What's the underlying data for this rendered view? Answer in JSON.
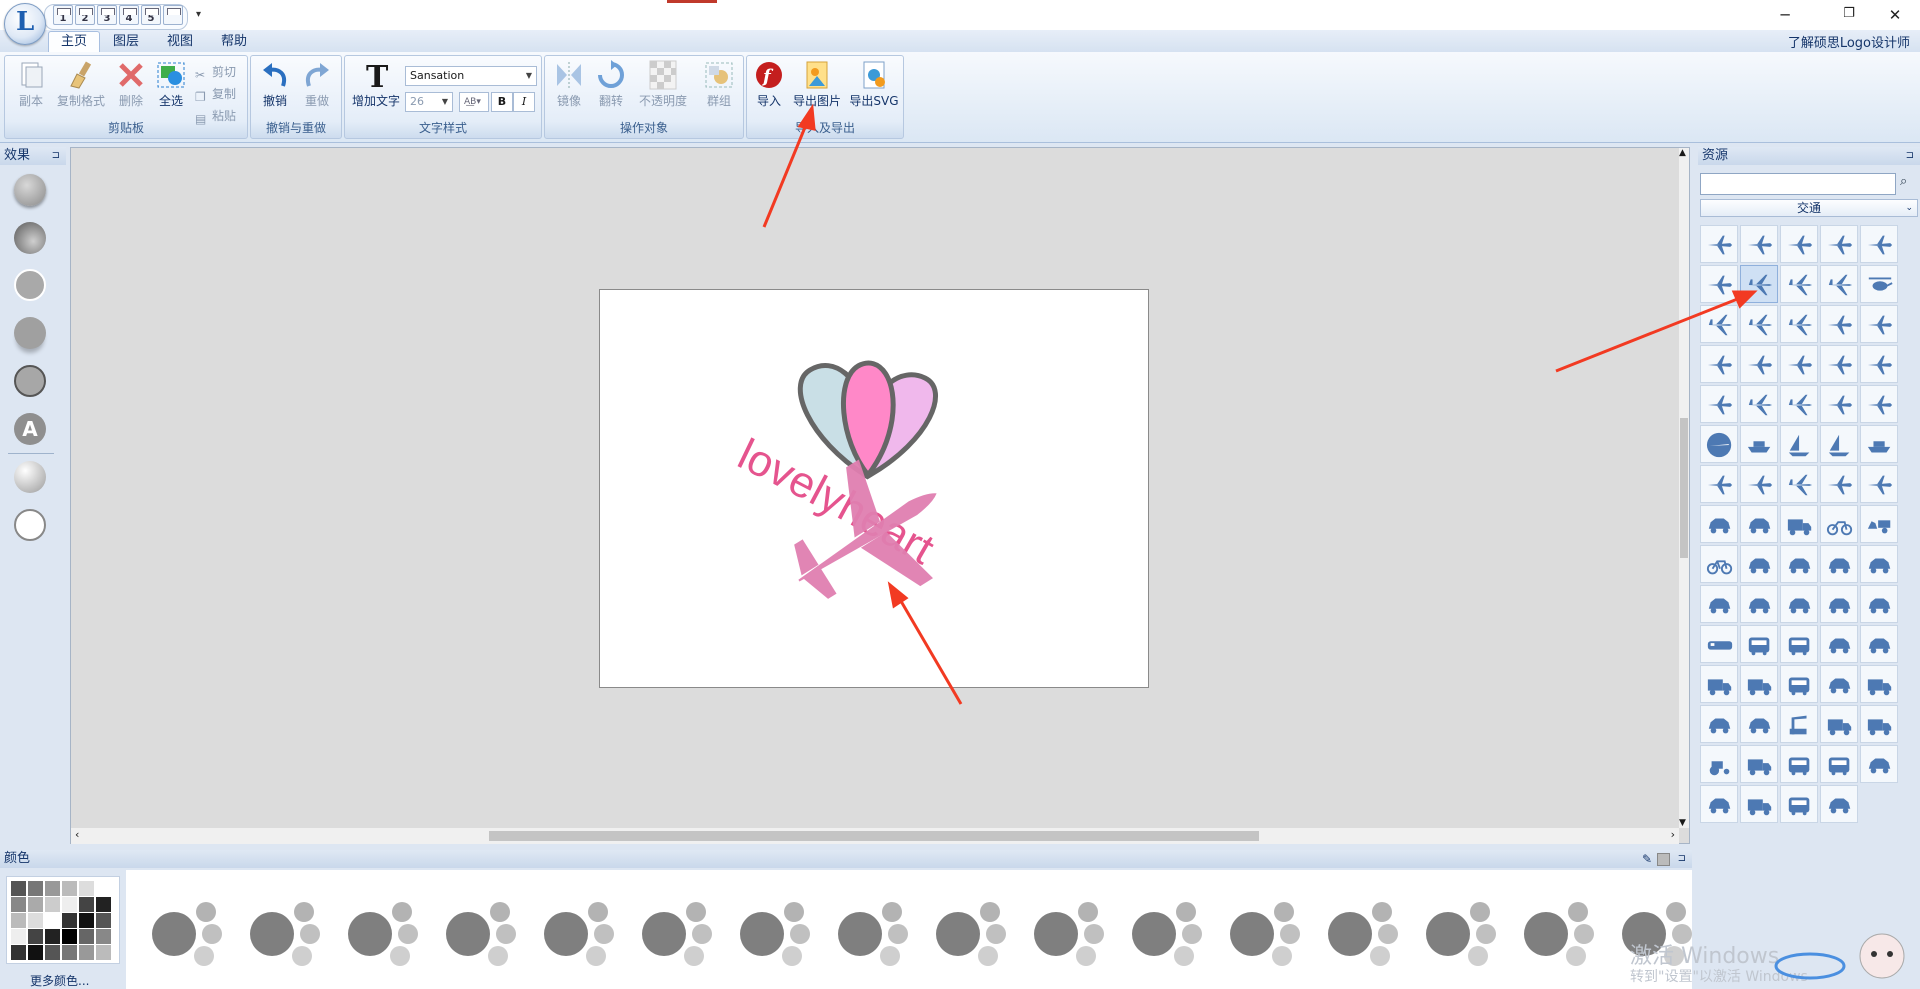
{
  "titlebar": {
    "qat_buttons": [
      "1",
      "2",
      "3",
      "4",
      "5"
    ],
    "help_link": "了解硕思Logo设计师"
  },
  "menu": {
    "tabs": [
      "主页",
      "图层",
      "视图",
      "帮助"
    ],
    "active_tab": "主页"
  },
  "ribbon": {
    "clipboard": {
      "label": "剪贴板",
      "copy_ghost": "副本",
      "format_painter": "复制格式",
      "delete": "删除",
      "select_all": "全选",
      "cut": "剪切",
      "copy": "复制",
      "paste": "粘贴"
    },
    "undo_redo": {
      "label": "撤销与重做",
      "undo": "撤销",
      "redo": "重做"
    },
    "text_style": {
      "label": "文字样式",
      "add_text": "增加文字",
      "font": "Sansation",
      "size": "26",
      "bold": "B",
      "italic": "I"
    },
    "operate": {
      "label": "操作对象",
      "mirror": "镜像",
      "flip": "翻转",
      "opacity": "不透明度",
      "group": "群组"
    },
    "import_export": {
      "label": "导入及导出",
      "import": "导入",
      "export_image": "导出图片",
      "export_svg": "导出SVG"
    }
  },
  "effects_panel": {
    "title": "效果",
    "effects": [
      "raised",
      "inset",
      "flat",
      "shadow",
      "outline",
      "text",
      "gradient",
      "ring"
    ]
  },
  "resources_panel": {
    "title": "资源",
    "search_value": "",
    "category": "交通",
    "icon_rows": [
      [
        "plane",
        "plane",
        "plane",
        "plane",
        "plane"
      ],
      [
        "plane",
        "jet",
        "jet",
        "jet",
        "helicopter"
      ],
      [
        "jet",
        "jet",
        "jet",
        "plane",
        "plane"
      ],
      [
        "plane",
        "plane",
        "plane",
        "plane",
        "plane"
      ],
      [
        "plane",
        "jet",
        "jet",
        "plane",
        "plane"
      ],
      [
        "plane-circle",
        "ship",
        "sailboat",
        "sailboat",
        "ship"
      ],
      [
        "plane",
        "plane",
        "jet",
        "plane",
        "plane"
      ],
      [
        "car",
        "car",
        "truck",
        "motorcycle",
        "horse-cart"
      ],
      [
        "bicycle",
        "car",
        "car",
        "car",
        "car"
      ],
      [
        "car",
        "car",
        "car",
        "car",
        "car"
      ],
      [
        "train",
        "bus",
        "bus",
        "car",
        "car"
      ],
      [
        "truck",
        "truck",
        "bus",
        "car",
        "truck"
      ],
      [
        "car",
        "car",
        "crane",
        "truck",
        "truck"
      ],
      [
        "tractor",
        "truck",
        "bus",
        "bus",
        "car"
      ],
      [
        "car",
        "truck",
        "bus",
        "car"
      ]
    ]
  },
  "canvas": {
    "logo_text": "lovelyheart",
    "heart_colors": [
      "#c9dfe6",
      "#ff88c8",
      "#f0b8ec"
    ],
    "text_color": "#e5548e",
    "plane_color": "#e07fb0"
  },
  "colors_panel": {
    "title": "颜色",
    "more_colors": "更多颜色...",
    "palette_count": 16
  },
  "watermark": {
    "line1": "激活 Windows",
    "line2": "转到\"设置\"以激活 Windows"
  },
  "accent": "#1e5fb0",
  "annotation_color": "#f23a22"
}
